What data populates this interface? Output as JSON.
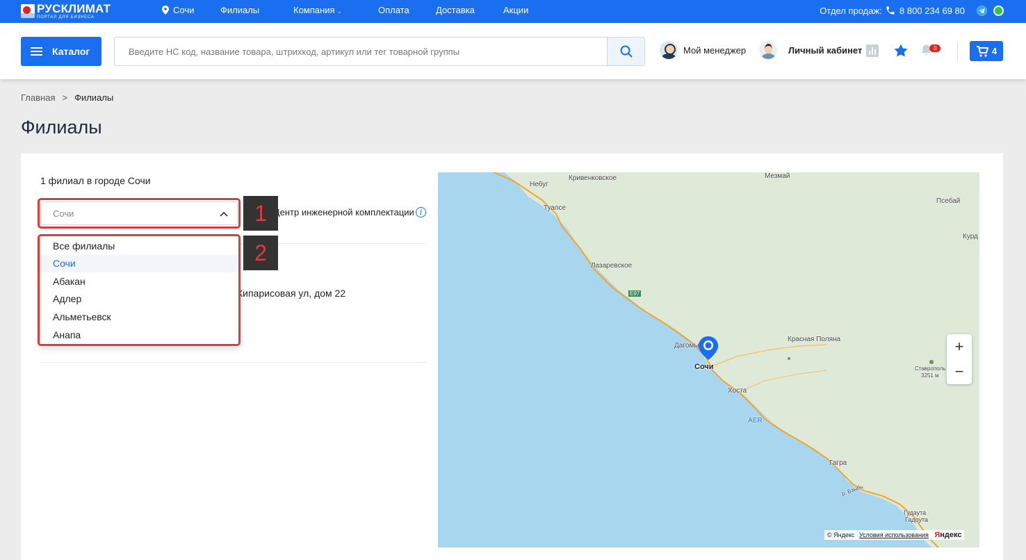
{
  "brand": {
    "name": "РУСКЛИМАТ",
    "subtitle": "ПОРТАЛ ДЛЯ БИЗНЕСА",
    "primary_color": "#1a6ff0"
  },
  "topbar": {
    "city": "Сочи",
    "nav": [
      "Филиалы",
      "Компания",
      "Оплата",
      "Доставка",
      "Акции"
    ],
    "sales_label": "Отдел продаж:",
    "phone": "8 800 234 69 80",
    "icons": [
      "location-pin-icon",
      "phone-icon",
      "telegram-icon",
      "whatsapp-icon"
    ]
  },
  "header": {
    "catalog_label": "Каталог",
    "search_placeholder": "Введите НС код, название товара, штрихкод, артикул или тег товарной группы",
    "manager_label": "Мой менеджер",
    "account_label": "Личный кабинет",
    "notifications_count": "0",
    "cart_count": "4"
  },
  "breadcrumb": {
    "home": "Главная",
    "separator": ">",
    "current": "Филиалы"
  },
  "page_title": "Филиалы",
  "branches": {
    "count_text": "1 филиал в городе Сочи",
    "select_value": "Сочи",
    "checkbox_label": "Центр инженерной комплектации",
    "address_partial": "Кипарисовая ул, дом 22",
    "dropdown_options": [
      "Все филиалы",
      "Сочи",
      "Абакан",
      "Адлер",
      "Альметьевск",
      "Анапа"
    ],
    "selected_option": "Сочи"
  },
  "annotations": [
    "1",
    "2"
  ],
  "map": {
    "labels": {
      "nebug": "Небуг",
      "krivenkovskoe": "Кривенковское",
      "mezmay": "Мезмай",
      "tuapse": "Туапсе",
      "psebay": "Псебай",
      "kurd": "Курд",
      "lazarevskoe": "Лазаревское",
      "e97": "E97",
      "krasnaya_polyana": "Красная Поляна",
      "dagomys": "Дагомыс",
      "sochi": "Сочи",
      "stavropol": "Ставрополь",
      "peak": "3251 м",
      "khosta": "Хоста",
      "aer": "AER",
      "gagra": "Гагра",
      "river": "р. Бзыбь",
      "gudauta": "Гудаута",
      "gadauta": "Гадоута"
    },
    "copyright": "© Яндекс",
    "terms": "Условия использования",
    "logo": "Яндекс",
    "zoom_in": "+",
    "zoom_out": "−",
    "sea_color": "#a9d6ef",
    "land_color": "#dfe9d8",
    "road_color": "#f5a623"
  }
}
